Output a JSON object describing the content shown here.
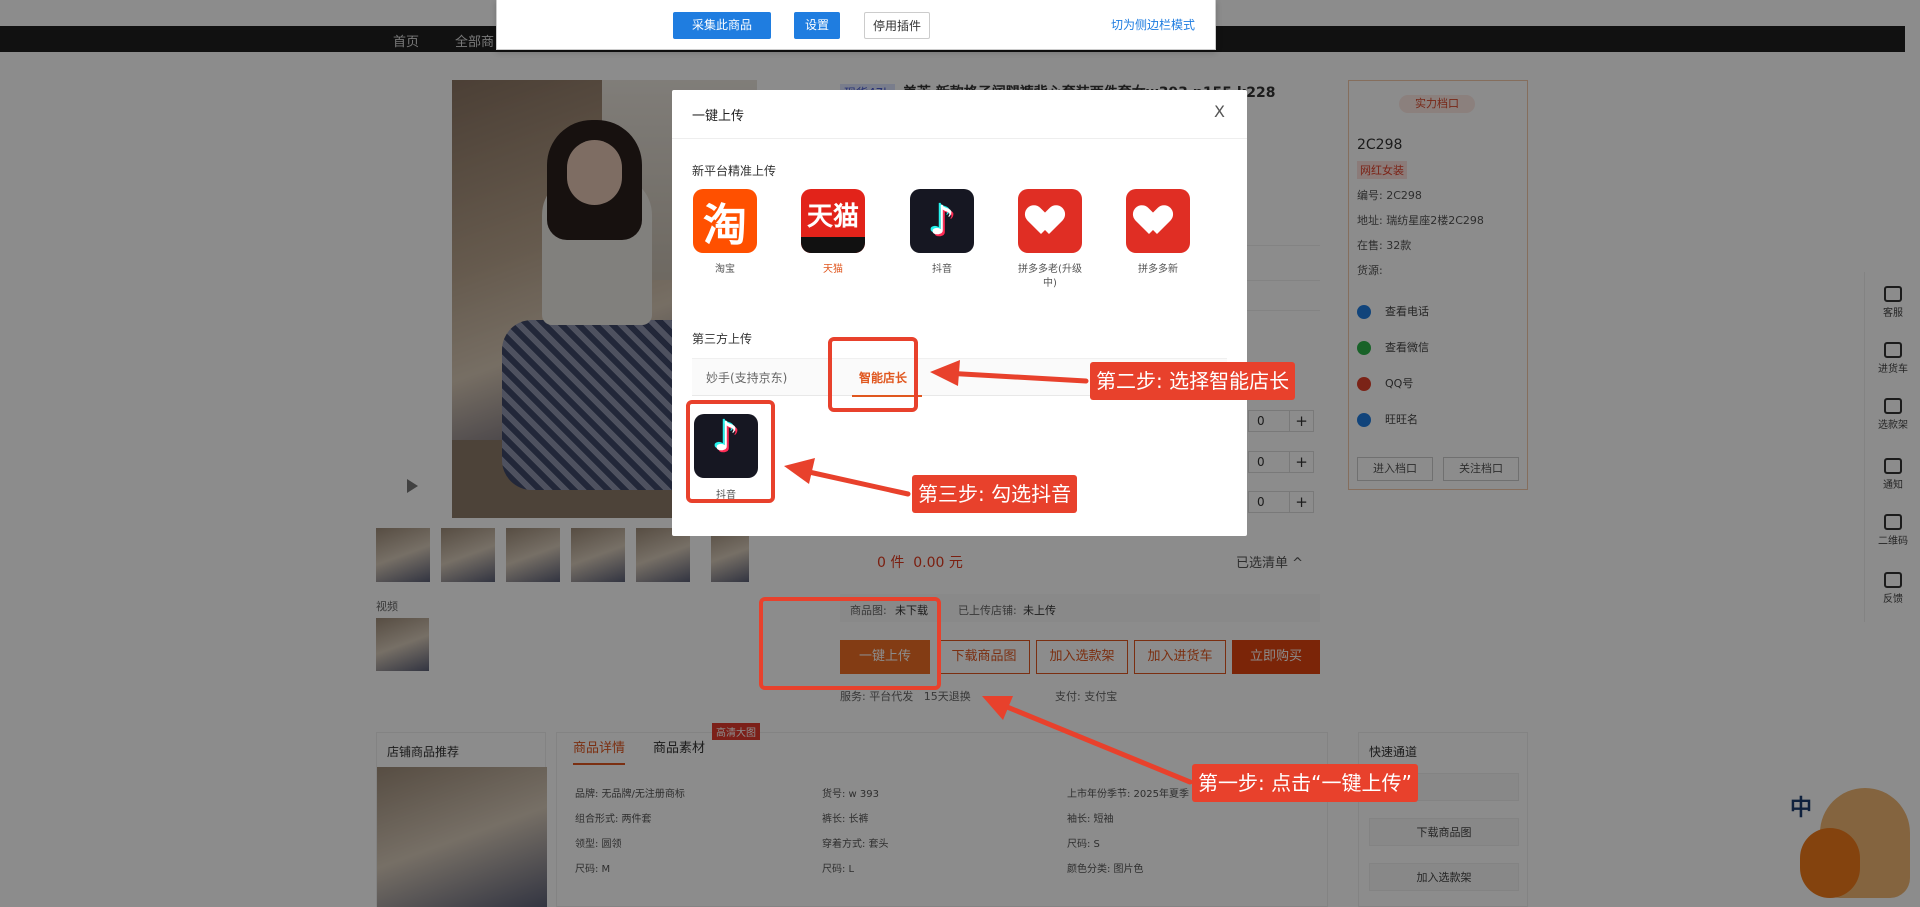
{
  "nav": {
    "items": [
      "首页",
      "全部商"
    ]
  },
  "plugin_bar": {
    "collect_label": "采集此商品",
    "settings_label": "设置",
    "disable_label": "停用插件",
    "sidebar_mode_label": "切为侧边栏模式"
  },
  "product": {
    "tag": "现货47h",
    "title": "美芳 新款格子阔腿裤背心套装两件套女w393 p155 k228",
    "qty_values": [
      "0",
      "0",
      "0"
    ],
    "qty_plus": "+",
    "sum_count": "0 件",
    "sum_price": "0.00 元",
    "selected_label": "已选清单 ^",
    "image_status_label": "商品图:",
    "image_status_value": "未下载",
    "uploaded_label": "已上传店铺:",
    "uploaded_value": "未上传",
    "video_label": "视频",
    "buttons": {
      "upload": "一键上传",
      "download": "下载商品图",
      "add_shelf": "加入选款架",
      "add_cart": "加入进货车",
      "buy": "立即购买"
    },
    "service_label": "服务:",
    "service_daifa": "平台代发",
    "service_return": "15天退换",
    "pay_label": "支付:",
    "pay_value": "支付宝"
  },
  "shop": {
    "badge": "实力档口",
    "name": "2C298",
    "category": "网红女装",
    "code": "编号: 2C298",
    "address": "地址: 瑞纺星座2楼2C298",
    "on_sale": "在售: 32款",
    "source": "货源:",
    "actions": [
      "查看电话",
      "查看微信",
      "QQ号",
      "旺旺名"
    ],
    "enter_label": "进入档口",
    "follow_label": "关注档口",
    "action_colors": [
      "#1f7de0",
      "#2db34a",
      "#e0402a",
      "#1f7de0"
    ]
  },
  "sidebar": {
    "items": [
      "客服",
      "进货车",
      "选款架",
      "通知",
      "二维码",
      "反馈"
    ]
  },
  "recommend": {
    "title": "店铺商品推荐"
  },
  "detail": {
    "tab_detail": "商品详情",
    "tab_material": "商品素材",
    "hd_badge": "高清大图",
    "attrs": [
      "品牌: 无品牌/无注册商标",
      "货号: w 393",
      "上市年份季节: 2025年夏季",
      "组合形式: 两件套",
      "裤长: 长裤",
      "袖长: 短袖",
      "领型: 圆领",
      "穿着方式: 套头",
      "尺码: S",
      "尺码: M",
      "尺码: L",
      "颜色分类: 图片色"
    ]
  },
  "quick": {
    "title": "快速通道",
    "download": "下载商品图",
    "add_shelf": "加入选款架"
  },
  "mascot": {
    "text": "中"
  },
  "modal": {
    "title": "一键上传",
    "close": "X",
    "new_platform_title": "新平台精准上传",
    "platforms": [
      {
        "label": "淘宝",
        "glyph": "淘"
      },
      {
        "label": "天猫",
        "glyph": "天猫"
      },
      {
        "label": "抖音",
        "glyph": "♪"
      },
      {
        "label": "拼多多老(升级中)",
        "glyph": ""
      },
      {
        "label": "拼多多新",
        "glyph": ""
      }
    ],
    "third_party_title": "第三方上传",
    "tabs": [
      "妙手(支持京东)",
      "智能店长"
    ],
    "douyin_label": "抖音",
    "douyin_glyph": "♪"
  },
  "annotations": {
    "step1": "第一步: 点击“一键上传”",
    "step2": "第二步: 选择智能店长",
    "step3": "第三步: 勾选抖音",
    "color": "#e8412c"
  }
}
